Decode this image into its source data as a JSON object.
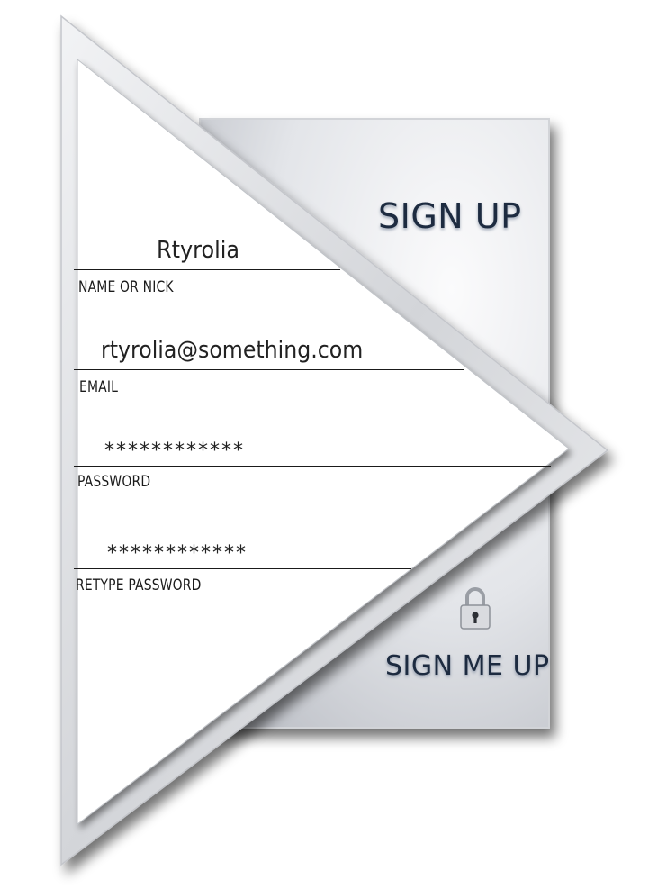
{
  "form": {
    "title": "SIGN UP",
    "submit_label": "SIGN ME UP",
    "fields": [
      {
        "label": "NAME OR NICK",
        "value": "Rtyrolia"
      },
      {
        "label": "EMAIL",
        "value": "rtyrolia@something.com"
      },
      {
        "label": "PASSWORD",
        "value": "************"
      },
      {
        "label": "RETYPE PASSWORD",
        "value": "************"
      }
    ]
  },
  "icons": {
    "submit": "lock-icon"
  },
  "colors": {
    "heading_text": "#1d2b40",
    "panel_light": "#f4f5f7",
    "panel_dark": "#c9ccd2",
    "triangle_fill": "#ffffff",
    "triangle_frame": "#d6d8dc"
  }
}
